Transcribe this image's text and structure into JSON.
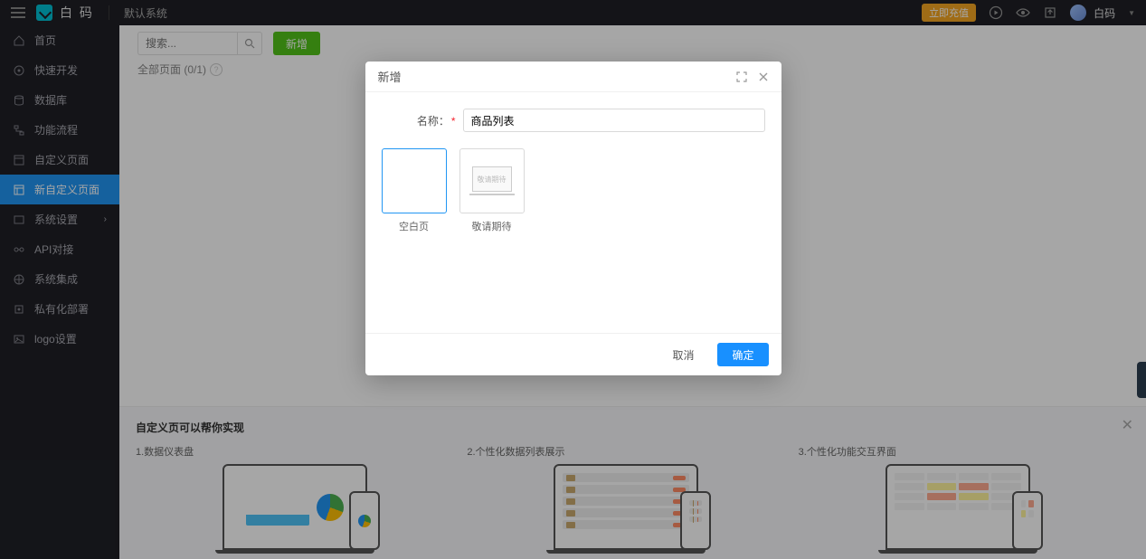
{
  "header": {
    "brand": "白 码",
    "system_label": "默认系统",
    "badge_text": "立即充值",
    "user_name": "白码"
  },
  "sidebar": {
    "items": [
      {
        "label": "首页",
        "icon": "home"
      },
      {
        "label": "快速开发",
        "icon": "rocket"
      },
      {
        "label": "数据库",
        "icon": "database"
      },
      {
        "label": "功能流程",
        "icon": "flow"
      },
      {
        "label": "自定义页面",
        "icon": "page"
      },
      {
        "label": "新自定义页面",
        "icon": "newpage",
        "active": true
      },
      {
        "label": "系统设置",
        "icon": "settings",
        "chevron": true
      },
      {
        "label": "API对接",
        "icon": "api"
      },
      {
        "label": "系统集成",
        "icon": "integrate"
      },
      {
        "label": "私有化部署",
        "icon": "deploy"
      },
      {
        "label": "logo设置",
        "icon": "logo"
      }
    ]
  },
  "toolbar": {
    "search_placeholder": "搜索...",
    "add_label": "新增"
  },
  "content": {
    "list_label": "全部页面 (0/1)"
  },
  "modal": {
    "title": "新增",
    "name_label": "名称：",
    "name_value": "商品列表",
    "templates": [
      {
        "label": "空白页",
        "type": "blank",
        "selected": true
      },
      {
        "label": "敬请期待",
        "type": "placeholder",
        "inner_text": "敬请期待"
      }
    ],
    "cancel_label": "取消",
    "confirm_label": "确定"
  },
  "info_panel": {
    "title": "自定义页可以帮你实现",
    "cols": [
      {
        "title": "1.数据仪表盘"
      },
      {
        "title": "2.个性化数据列表展示"
      },
      {
        "title": "3.个性化功能交互界面"
      }
    ]
  }
}
